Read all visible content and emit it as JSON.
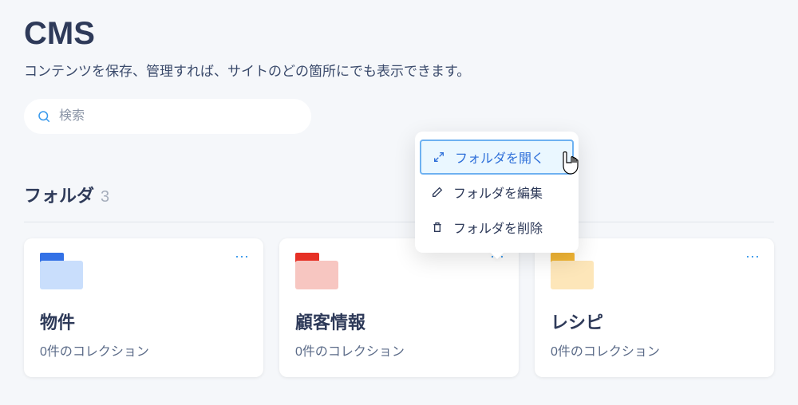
{
  "header": {
    "title": "CMS",
    "subtitle": "コンテンツを保存、管理すれば、サイトのどの箇所にでも表示できます。"
  },
  "search": {
    "placeholder": "検索"
  },
  "section": {
    "title": "フォルダ",
    "count": "3"
  },
  "folders": [
    {
      "name": "物件",
      "sub": "0件のコレクション",
      "color": "blue"
    },
    {
      "name": "顧客情報",
      "sub": "0件のコレクション",
      "color": "red"
    },
    {
      "name": "レシピ",
      "sub": "0件のコレクション",
      "color": "yellow"
    }
  ],
  "contextMenu": {
    "open": "フォルダを開く",
    "edit": "フォルダを編集",
    "delete": "フォルダを削除"
  }
}
